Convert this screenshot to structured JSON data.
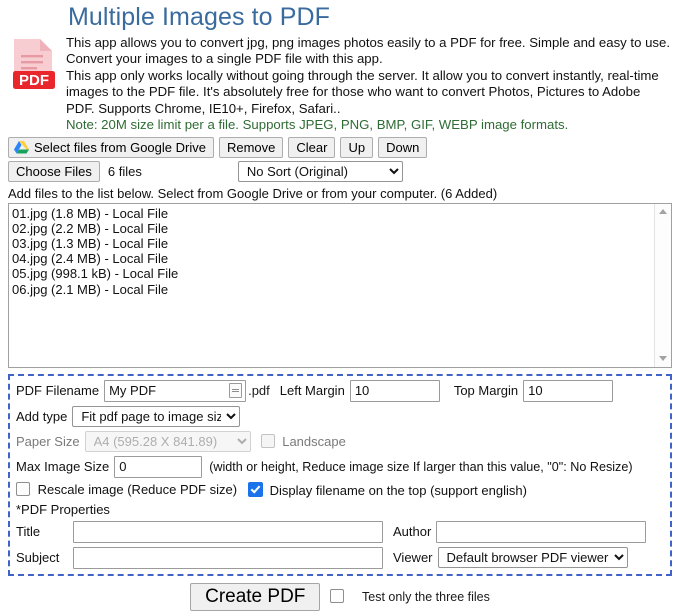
{
  "header": {
    "title": "Multiple Images to PDF",
    "icon": "pdf-file-icon",
    "icon_badge": "PDF",
    "paragraphs": [
      "This app allows you to convert jpg, png images photos easily to a PDF for free. Simple and easy to use. Convert your images to a single PDF file with this app.",
      "This app only works locally without going through the server. It allow you to convert instantly, real-time images to the PDF file. It's absolutely free for those who want to convert Photos, Pictures to Adobe PDF. Supports Chrome, IE10+, Firefox, Safari.."
    ],
    "note": "Note: 20M size limit per a file. Supports JPEG, PNG, BMP, GIF, WEBP image formats.",
    "title_color": "#3a6b9e",
    "note_color": "#2f6b34"
  },
  "toolbar": {
    "google_drive_button": "Select files from Google Drive",
    "google_drive_icon": "google-drive-icon",
    "remove_button": "Remove",
    "clear_button": "Clear",
    "up_button": "Up",
    "down_button": "Down",
    "choose_files_button": "Choose Files",
    "file_count_text": "6 files",
    "sort_selected": "No Sort (Original)",
    "sort_options": [
      "No Sort (Original)"
    ],
    "hint": "Add files to the list below. Select from Google Drive or from your computer. (6 Added)"
  },
  "file_list": {
    "items": [
      "01.jpg (1.8 MB) - Local File",
      "02.jpg (2.2 MB) - Local File",
      "03.jpg (1.3 MB) - Local File",
      "04.jpg (2.4 MB) - Local File",
      "05.jpg (998.1 kB) - Local File",
      "06.jpg (2.1 MB) - Local File"
    ],
    "scroll_up_icon": "scroll-up-arrow-icon",
    "scroll_down_icon": "scroll-down-arrow-icon"
  },
  "options": {
    "border_color": "#3f63c9",
    "pdf_filename_label": "PDF Filename",
    "pdf_filename_value": "My PDF",
    "pdf_filename_extension": ".pdf",
    "left_margin_label": "Left Margin",
    "left_margin_value": "10",
    "top_margin_label": "Top Margin",
    "top_margin_value": "10",
    "add_type_label": "Add type",
    "add_type_selected": "Fit pdf page to image size",
    "paper_size_label": "Paper Size",
    "paper_size_selected": "A4 (595.28 X 841.89)",
    "landscape_label": "Landscape",
    "landscape_checked": false,
    "max_image_size_label": "Max Image Size",
    "max_image_size_value": "0",
    "max_image_size_hint": "(width or height, Reduce image size If larger than this value, \"0\": No Resize)",
    "rescale_label": "Rescale image (Reduce PDF size)",
    "rescale_checked": false,
    "display_filename_label": "Display filename on the top (support english)",
    "display_filename_checked": true,
    "pdf_properties_label": "*PDF Properties",
    "title_label": "Title",
    "title_value": "",
    "author_label": "Author",
    "author_value": "",
    "subject_label": "Subject",
    "subject_value": "",
    "viewer_label": "Viewer",
    "viewer_selected": "Default browser PDF viewer"
  },
  "footer": {
    "create_button": "Create PDF",
    "test_checkbox_label": "Test only the three files",
    "test_checkbox_checked": false
  }
}
